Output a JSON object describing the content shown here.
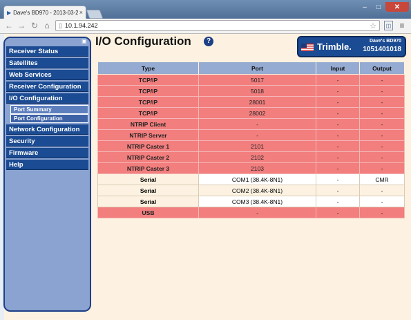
{
  "browser": {
    "tab_title": "Dave's BD970 - 2013-03-2",
    "url": "10.1.94.242",
    "window_controls": [
      "–",
      "□",
      "✕"
    ]
  },
  "page": {
    "title": "I/O Configuration",
    "brand": {
      "logo": "Trimble.",
      "device_name": "Dave's BD970",
      "serial": "1051401018"
    }
  },
  "sidebar": {
    "items": [
      {
        "label": "Receiver Status"
      },
      {
        "label": "Satellites"
      },
      {
        "label": "Web Services"
      },
      {
        "label": "Receiver Configuration"
      },
      {
        "label": "I/O Configuration",
        "active": true
      },
      {
        "label": "Network Configuration"
      },
      {
        "label": "Security"
      },
      {
        "label": "Firmware"
      },
      {
        "label": "Help"
      }
    ],
    "submenu": [
      {
        "label": "Port Summary"
      },
      {
        "label": "Port Configuration"
      }
    ]
  },
  "table": {
    "headers": [
      "Type",
      "Port",
      "Input",
      "Output"
    ],
    "rows": [
      {
        "type": "TCP/IP",
        "port": "5017",
        "input": "-",
        "output": "-",
        "style": "red"
      },
      {
        "type": "TCP/IP",
        "port": "5018",
        "input": "-",
        "output": "-",
        "style": "red"
      },
      {
        "type": "TCP/IP",
        "port": "28001",
        "input": "-",
        "output": "-",
        "style": "red"
      },
      {
        "type": "TCP/IP",
        "port": "28002",
        "input": "-",
        "output": "-",
        "style": "red"
      },
      {
        "type": "NTRIP Client",
        "port": "-",
        "input": "-",
        "output": "-",
        "style": "red"
      },
      {
        "type": "NTRIP Server",
        "port": "-",
        "input": "-",
        "output": "-",
        "style": "red"
      },
      {
        "type": "NTRIP Caster 1",
        "port": "2101",
        "input": "-",
        "output": "-",
        "style": "red"
      },
      {
        "type": "NTRIP Caster 2",
        "port": "2102",
        "input": "-",
        "output": "-",
        "style": "red"
      },
      {
        "type": "NTRIP Caster 3",
        "port": "2103",
        "input": "-",
        "output": "-",
        "style": "red"
      },
      {
        "type": "Serial",
        "port": "COM1 (38.4K-8N1)",
        "input": "-",
        "output": "CMR",
        "style": "white"
      },
      {
        "type": "Serial",
        "port": "COM2 (38.4K-8N1)",
        "input": "-",
        "output": "-",
        "style": "cream"
      },
      {
        "type": "Serial",
        "port": "COM3 (38.4K-8N1)",
        "input": "-",
        "output": "-",
        "style": "white"
      },
      {
        "type": "USB",
        "port": "-",
        "input": "-",
        "output": "-",
        "style": "red"
      }
    ]
  },
  "colors": {
    "accent": "#1b4b92",
    "row_red": "#f27e7e",
    "page_bg": "#fdf2e1",
    "header_blue": "#96abd2"
  }
}
